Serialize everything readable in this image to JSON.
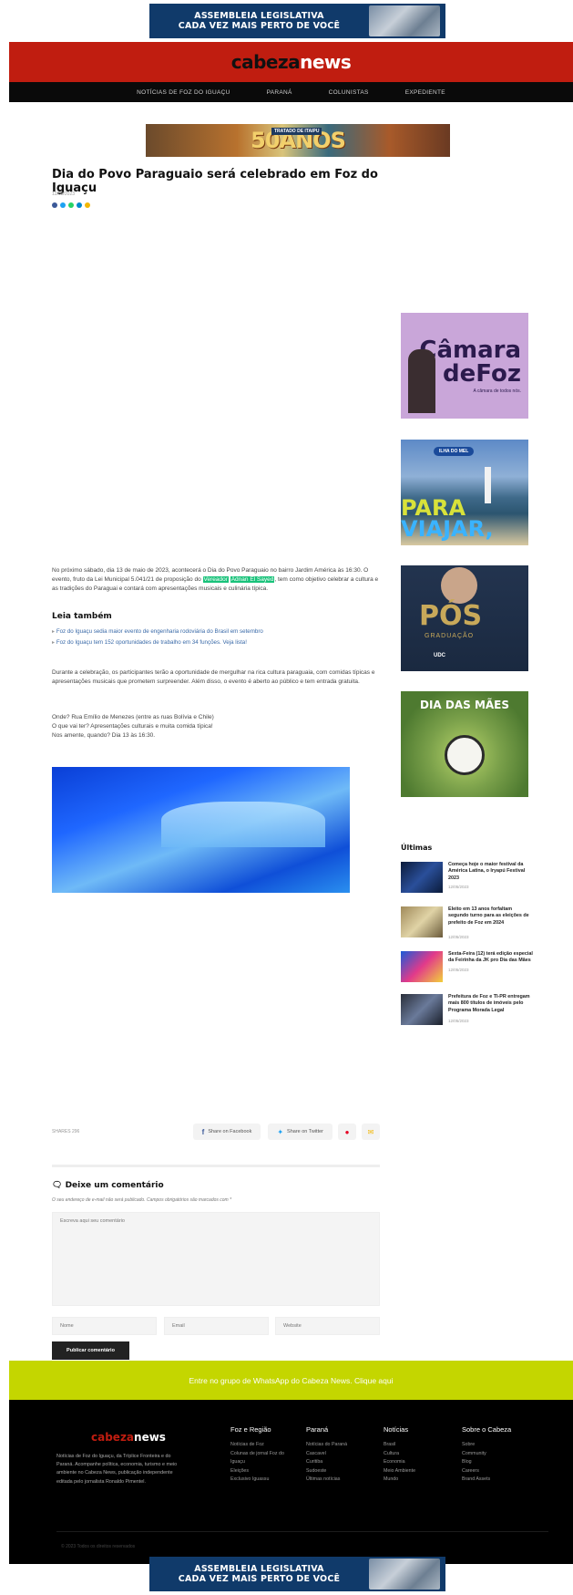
{
  "ad_top": {
    "line1": "ASSEMBLEIA LEGISLATIVA",
    "line2": "CADA VEZ MAIS PERTO DE VOCÊ"
  },
  "header": {
    "logo_part1": "cabeza",
    "logo_part2": "news"
  },
  "nav": {
    "items": [
      "NOTÍCIAS DE FOZ DO IGUAÇU",
      "PARANÁ",
      "COLUNISTAS",
      "EXPEDIENTE"
    ]
  },
  "ad_itaipu": {
    "tag": "TRATADO DE ITAIPU",
    "main": "50ANOS"
  },
  "article": {
    "title": "Dia do Povo Paraguaio será celebrado em Foz do Iguaçu",
    "date": "12/05/2023",
    "p1_a": "No próximo sábado, dia 13 de maio de 2023, acontecerá o Dia do Povo Paraguaio no bairro Jardim América às 16:30. O evento, fruto da Lei Municipal 5.041/21 de proposição do ",
    "p1_hl1": "Vereador",
    "p1_hl2": "Adnan El Sayed",
    "p1_b": ", tem como objetivo celebrar a cultura e as tradições do Paraguai e contará com apresentações musicais e culinária típica.",
    "leia_title": "Leia também",
    "leia": [
      "Foz do Iguaçu sedia maior evento de engenharia rodoviária do Brasil em setembro",
      "Foz do Iguaçu tem 152 oportunidades de trabalho em 34 funções. Veja lista!"
    ],
    "p2": "Durante a celebração, os participantes terão a oportunidade de mergulhar na rica cultura paraguaia, com comidas típicas e apresentações musicais que prometem surpreender. Além disso, o evento é aberto ao público e tem entrada gratuita.",
    "p3_l1": "Onde? Rua Emílio de Menezes (entre as ruas Bolívia e Chile)",
    "p3_l2": "O que vai ter? Apresentações culturais e muita comida típica!",
    "p3_l3": "Nos amente, quando? Dia 13 às 16:30."
  },
  "sidebar_ads": {
    "camara": {
      "line1": "Câmara",
      "line2": "deFoz",
      "line3": "A câmara de todos nós."
    },
    "ilha": {
      "tag": "ILHA DO MEL",
      "line1": "PARA",
      "line2": "VIAJAR,"
    },
    "pos": {
      "line1": "PÓS",
      "line2": "GRADUAÇÃO",
      "brand": "UDC"
    },
    "maes": {
      "title": "DIA DAS MÃES"
    }
  },
  "ultimas": {
    "title": "Últimas",
    "items": [
      {
        "title": "Começa hoje o maior festival da América Latina, o Iryapú Festival 2023",
        "date": "12/05/2023"
      },
      {
        "title": "Eleito em 13 anos forfaltam segundo turno para as eleições de prefeito de Foz em 2024",
        "date": "12/05/2023"
      },
      {
        "title": "Sexta-Feira (12) terá edição especial da Feirinha da JK pro Dia das Mães",
        "date": "12/05/2023"
      },
      {
        "title": "Prefeitura de Foz e TI-PR entregam mais 800 títulos de imóveis pelo Programa Morada Legal",
        "date": "12/05/2023"
      }
    ]
  },
  "share": {
    "count": "SHARES 296",
    "facebook": "Share on Facebook",
    "twitter": "Share on Twitter"
  },
  "comments": {
    "title": "Deixe um comentário",
    "note": "O seu endereço de e-mail não será publicado. Campos obrigatórios são marcados com *",
    "placeholder": "Escreva aqui seu comentário",
    "name_placeholder": "Nome",
    "email_placeholder": "Email",
    "site_placeholder": "Website",
    "submit": "Publicar comentário"
  },
  "whatsapp": {
    "text": "Entre no grupo de WhatsApp do Cabeza News. Clique aqui"
  },
  "footer": {
    "logo_part1": "cabeza",
    "logo_part2": "news",
    "about": "Notícias de Foz do Iguaçu, da Tríplice Fronteira e do Paraná. Acompanhe política, economia, turismo e meio ambiente no Cabeza News, publicação independente editada pelo jornalista Ronaldo Pimentel.",
    "cols": [
      {
        "title": "Foz e Região",
        "links": [
          "Notícias de Foz",
          "Colunas de jornal Foz do Iguaçu",
          "Eleições",
          "Exclusivo Iguassu"
        ]
      },
      {
        "title": "Paraná",
        "links": [
          "Notícias do Paraná",
          "Cascavel",
          "Curitiba",
          "Sudoeste",
          "Últimas notícias"
        ]
      },
      {
        "title": "Notícias",
        "links": [
          "Brasil",
          "Cultura",
          "Economia",
          "Meio Ambiente",
          "Mundo"
        ]
      },
      {
        "title": "Sobre o Cabeza",
        "links": [
          "Sobre",
          "Community",
          "Blog",
          "Careers",
          "Brand Assets"
        ]
      }
    ],
    "copyright": "© 2023 Todos os direitos reservados"
  },
  "ad_bottom": {
    "line1": "ASSEMBLEIA LEGISLATIVA",
    "line2": "CADA VEZ MAIS PERTO DE VOCÊ"
  }
}
